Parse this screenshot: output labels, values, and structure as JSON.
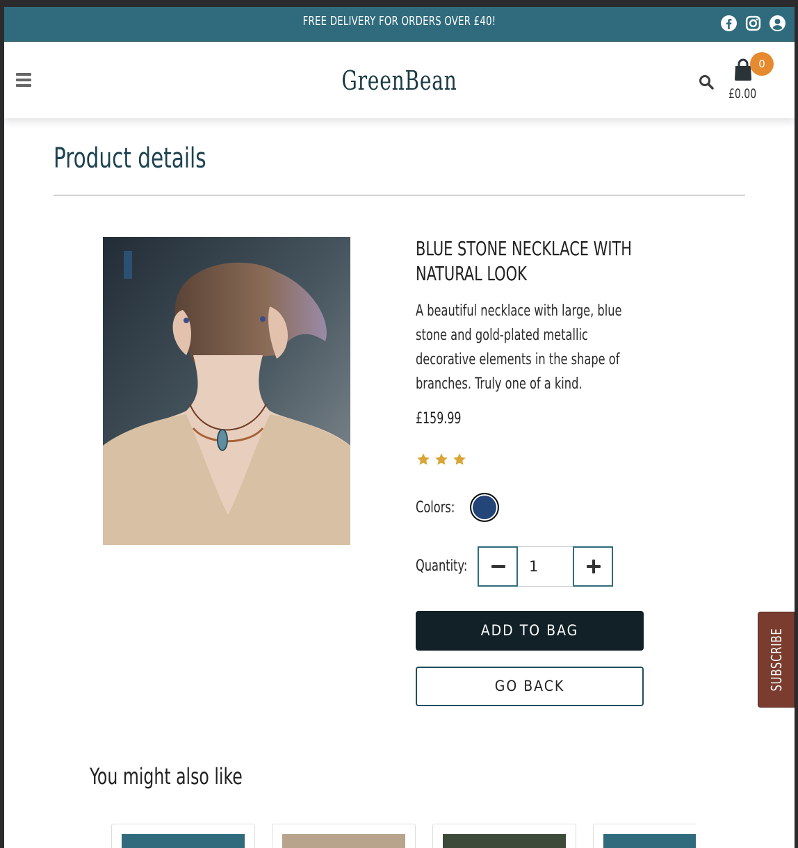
{
  "banner": {
    "text": "FREE DELIVERY FOR ORDERS OVER £40!",
    "icons": [
      "facebook-icon",
      "instagram-icon",
      "account-icon"
    ]
  },
  "header": {
    "logo": "GreenBean",
    "menu_icon": "hamburger-menu-icon",
    "search_icon": "search-icon",
    "bag_icon": "shopping-bag-icon",
    "bag_count": "0",
    "bag_total": "£0.00"
  },
  "page": {
    "title": "Product details"
  },
  "product": {
    "name": "BLUE STONE NECKLACE WITH NATURAL LOOK",
    "description": "A beautiful necklace with large, blue stone and gold-plated metallic decorative elements in the shape of branches. Truly one of a kind.",
    "price": "£159.99",
    "rating": 3,
    "colors_label": "Colors:",
    "colors": [
      "#234577"
    ],
    "quantity_label": "Quantity:",
    "quantity": "1"
  },
  "actions": {
    "add_to_bag": "ADD TO BAG",
    "go_back": "GO BACK"
  },
  "subscribe": {
    "label": "SUBSCRIBE"
  },
  "related": {
    "title": "You might also like"
  },
  "colors": {
    "banner": "#2f6b7c",
    "accent_orange": "#e58a2f",
    "star": "#d9a534",
    "dark_button": "#112127",
    "subscribe_tab": "#7a3c2e"
  }
}
